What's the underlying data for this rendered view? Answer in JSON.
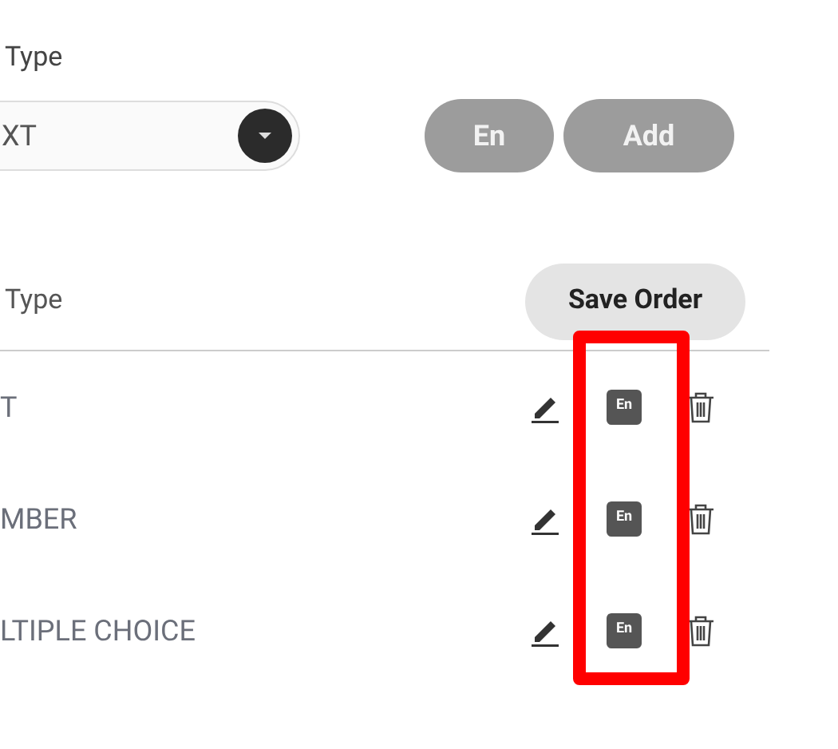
{
  "type_label": "Type",
  "type_select": {
    "value": "XT"
  },
  "buttons": [
    {
      "label": "En",
      "disabled": true
    },
    {
      "label": "Add",
      "disabled": true
    }
  ],
  "list_header": {
    "label": "Type",
    "save_button": "Save Order"
  },
  "rows": [
    {
      "label": "T",
      "language": "En"
    },
    {
      "label": "MBER",
      "language": "En"
    },
    {
      "label": "LTIPLE CHOICE",
      "language": "En"
    }
  ],
  "highlight": {
    "color": "#ff0000"
  }
}
